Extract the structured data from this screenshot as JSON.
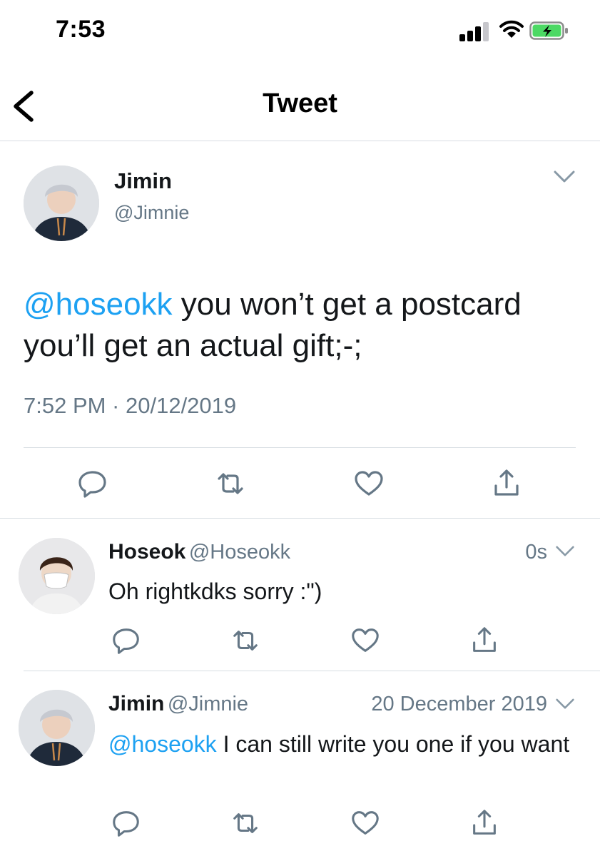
{
  "status_bar": {
    "time": "7:53",
    "battery_color": "#4cd964"
  },
  "header": {
    "title": "Tweet"
  },
  "main_tweet": {
    "name": "Jimin",
    "handle": "@Jimnie",
    "mention": "@hoseokk",
    "text": " you won’t get a postcard you’ll get an actual gift;-;",
    "timestamp": "7:52 PM · 20/12/2019"
  },
  "replies": [
    {
      "name": "Hoseok",
      "handle": "@Hoseokk",
      "time": "0s",
      "mention": "",
      "text": "Oh rightkdks sorry :\")"
    },
    {
      "name": "Jimin",
      "handle": "@Jimnie",
      "time": "20 December 2019",
      "mention": "@hoseokk",
      "text": " I can still write you one if you want"
    }
  ],
  "actions": [
    "reply-icon",
    "retweet-icon",
    "like-icon",
    "share-icon"
  ],
  "colors": {
    "link": "#1da1f2",
    "secondary": "#657786",
    "icon": "#657786",
    "divider": "#d8dde2"
  }
}
